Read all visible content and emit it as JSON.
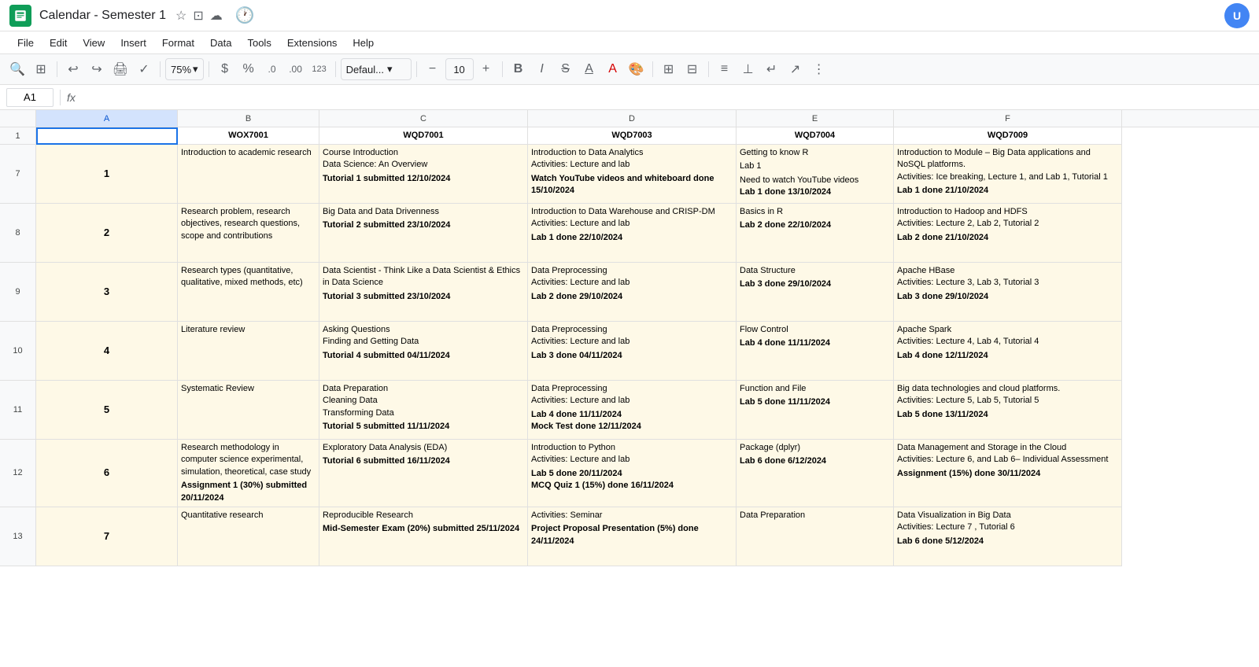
{
  "titleBar": {
    "appName": "Calendar - Semester 1",
    "starIcon": "★",
    "saveIcon": "⊡",
    "cloudIcon": "☁",
    "historyIcon": "🕐",
    "profileInitial": "U"
  },
  "menuBar": {
    "items": [
      "File",
      "Edit",
      "View",
      "Insert",
      "Format",
      "Data",
      "Tools",
      "Extensions",
      "Help"
    ]
  },
  "toolbar": {
    "zoomLevel": "75%",
    "currency": "$",
    "percent": "%",
    "decimal1": ".0",
    "decimal2": ".00",
    "format123": "123",
    "fontFamily": "Defaul...",
    "fontSize": "10"
  },
  "formulaBar": {
    "cellRef": "A1",
    "fxLabel": "fx"
  },
  "columns": {
    "headers": [
      "A",
      "B",
      "C",
      "D",
      "E",
      "F"
    ],
    "widths": [
      46,
      180,
      265,
      265,
      200,
      290
    ]
  },
  "rows": {
    "numbers": [
      1,
      7,
      8,
      9,
      10,
      11,
      12,
      13
    ]
  },
  "headerRow": {
    "a": "",
    "b": "WOX7001",
    "c": "WQD7001",
    "d": "WQD7003",
    "e": "WQD7004",
    "f": "WQD7009"
  },
  "dataRows": [
    {
      "rowNum": "1",
      "a": "1",
      "b": "Introduction to academic research",
      "c": "Course Introduction\nData Science: An Overview\n\nTutorial 1 submitted 12/10/2024",
      "c_bold": "Tutorial 1 submitted 12/10/2024",
      "d": "Introduction to Data Analytics\nActivities: Lecture and lab\n\nWatch YouTube videos and whiteboard done 15/10/2024",
      "d_bold": "Watch YouTube videos and whiteboard done 15/10/2024",
      "e": "Getting to know R\n\nLab 1\n\nNeed to watch YouTube videos\nLab 1 done 13/10/2024",
      "e_bold": "Lab 1 done 13/10/2024",
      "f": "Introduction to Module – Big Data applications and NoSQL platforms.\nActivities: Ice breaking, Lecture 1, and Lab 1, Tutorial 1\n\nLab 1 done 21/10/2024",
      "f_bold": "Lab 1 done 21/10/2024"
    },
    {
      "rowNum": "2",
      "a": "2",
      "b": "Research problem, research objectives, research questions, scope and contributions",
      "c": "Big Data and Data Drivenness\n\nTutorial 2 submitted 23/10/2024",
      "c_bold": "Tutorial 2 submitted 23/10/2024",
      "d": "Introduction to Data Warehouse and CRISP-DM\nActivities: Lecture and lab\n\nLab 1 done 22/10/2024",
      "d_bold": "Lab 1 done 22/10/2024",
      "e": "Basics in R\n\nLab 2 done 22/10/2024",
      "e_bold": "Lab 2 done 22/10/2024",
      "f": "Introduction to Hadoop and HDFS\nActivities: Lecture 2, Lab 2, Tutorial 2\n\nLab 2 done 21/10/2024",
      "f_bold": "Lab 2 done 21/10/2024"
    },
    {
      "rowNum": "3",
      "a": "3",
      "b": "Research types (quantitative, qualitative, mixed methods, etc)",
      "c": "Data Scientist - Think Like a Data Scientist & Ethics in Data Science\n\nTutorial 3 submitted 23/10/2024",
      "c_bold": "Tutorial 3 submitted 23/10/2024",
      "d": "Data Preprocessing\nActivities: Lecture and lab\n\nLab 2 done 29/10/2024",
      "d_bold": "Lab 2 done 29/10/2024",
      "e": "Data Structure\n\nLab 3 done 29/10/2024",
      "e_bold": "Lab 3 done 29/10/2024",
      "f": "Apache HBase\nActivities: Lecture 3, Lab 3, Tutorial 3\n\nLab 3 done 29/10/2024",
      "f_bold": "Lab 3 done 29/10/2024"
    },
    {
      "rowNum": "4",
      "a": "4",
      "b": "Literature review",
      "c": "Asking Questions\nFinding and Getting Data\n\nTutorial 4 submitted 04/11/2024",
      "c_bold": "Tutorial 4 submitted 04/11/2024",
      "d": "Data Preprocessing\nActivities: Lecture and lab\n\nLab 3 done 04/11/2024",
      "d_bold": "Lab 3 done 04/11/2024",
      "e": "Flow Control\n\nLab 4 done 11/11/2024",
      "e_bold": "Lab 4 done 11/11/2024",
      "f": "Apache Spark\nActivities: Lecture 4, Lab 4, Tutorial 4\n\nLab 4 done 12/11/2024",
      "f_bold": "Lab 4 done 12/11/2024"
    },
    {
      "rowNum": "5",
      "a": "5",
      "b": "Systematic Review",
      "c": "Data Preparation\nCleaning Data\nTransforming Data\n\nTutorial 5 submitted 11/11/2024",
      "c_bold": "Tutorial 5 submitted 11/11/2024",
      "d": "Data Preprocessing\nActivities: Lecture and lab\n\nLab 4 done 11/11/2024\nMock Test done 12/11/2024",
      "d_bold": "Lab 4 done 11/11/2024\nMock Test done 12/11/2024",
      "e": "Function and File\n\nLab 5 done 11/11/2024",
      "e_bold": "Lab 5 done 11/11/2024",
      "f": "Big data technologies and cloud platforms.\nActivities: Lecture 5, Lab 5, Tutorial 5\n\nLab 5 done 13/11/2024",
      "f_bold": "Lab 5 done 13/11/2024"
    },
    {
      "rowNum": "6",
      "a": "6",
      "b": "Research methodology in computer science experimental, simulation, theoretical, case study\n\nAssignment 1 (30%) submitted 20/11/2024",
      "b_bold": "Assignment 1 (30%) submitted 20/11/2024",
      "c": "Exploratory Data Analysis (EDA)\n\nTutorial 6 submitted 16/11/2024",
      "c_bold": "Tutorial 6 submitted 16/11/2024",
      "d": "Introduction to Python\nActivities: Lecture and lab\n\nLab 5 done 20/11/2024\nMCQ Quiz 1 (15%) done 16/11/2024",
      "d_bold": "Lab 5 done 20/11/2024\nMCQ Quiz 1 (15%) done 16/11/2024",
      "e": "Package (dplyr)\n\nLab 6 done 6/12/2024",
      "e_bold": "Lab 6 done 6/12/2024",
      "f": "Data Management and Storage in the Cloud\nActivities: Lecture 6, and Lab 6– Individual Assessment\n\nAssignment (15%) done 30/11/2024",
      "f_bold": "Assignment (15%) done 30/11/2024"
    },
    {
      "rowNum": "7",
      "a": "7",
      "b": "Quantitative research",
      "c": "Reproducible Research\n\nMid-Semester Exam (20%) submitted 25/11/2024",
      "c_bold": "Mid-Semester Exam (20%) submitted 25/11/2024",
      "d": "Activities: Seminar\n\nProject Proposal Presentation (5%) done 24/11/2024",
      "d_bold": "Project Proposal Presentation (5%) done 24/11/2024",
      "e": "Data Preparation",
      "e_bold": "",
      "f": "Data Visualization in Big Data\nActivities: Lecture 7 , Tutorial 6\n\nLab 6 done 5/12/2024",
      "f_bold": "Lab 6 done 5/12/2024"
    }
  ]
}
